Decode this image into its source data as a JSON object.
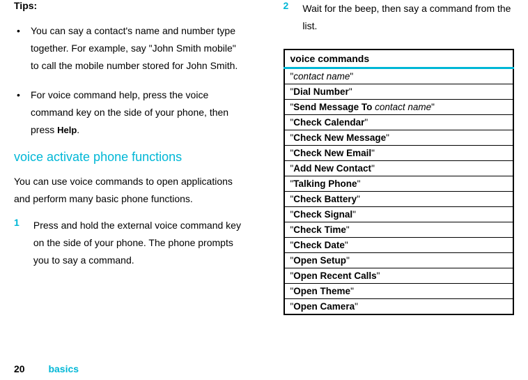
{
  "left": {
    "tips_label": "Tips:",
    "bullets": [
      "You can say a contact's name and number type together. For example, say \"John Smith mobile\" to call the mobile number stored for John Smith.",
      "For voice command help, press the voice command key on the side of your phone, then press "
    ],
    "help_label": "Help",
    "bullet2_suffix": ".",
    "section_heading": "voice activate phone functions",
    "intro_para": "You can use voice commands to open applications and perform many basic phone functions.",
    "step1_number": "1",
    "step1_text": "Press and hold the external voice command key on the side of your phone. The phone prompts you to say a command."
  },
  "right": {
    "step2_number": "2",
    "step2_text": "Wait for the beep, then say a command from the list.",
    "table_header": "voice commands",
    "rows": [
      {
        "prefix": "\"",
        "italic": "contact name",
        "bold": "",
        "suffix": "\""
      },
      {
        "prefix": "\"",
        "bold": "Dial Number",
        "suffix": "\""
      },
      {
        "prefix": "\"",
        "bold": "Send Message To",
        "italic": " contact name",
        "suffix": "\""
      },
      {
        "prefix": "\"",
        "bold": "Check Calendar",
        "suffix": "\""
      },
      {
        "prefix": "\"",
        "bold": "Check New Message",
        "suffix": "\""
      },
      {
        "prefix": "\"",
        "bold": "Check New Email",
        "suffix": "\""
      },
      {
        "prefix": "\"",
        "bold": "Add New Contact",
        "suffix": "\""
      },
      {
        "prefix": "\"",
        "bold": "Talking Phone",
        "suffix": "\""
      },
      {
        "prefix": "\"",
        "bold": "Check Battery",
        "suffix": "\""
      },
      {
        "prefix": "\"",
        "bold": "Check Signal",
        "suffix": "\""
      },
      {
        "prefix": "\"",
        "bold": "Check Time",
        "suffix": "\""
      },
      {
        "prefix": "\"",
        "bold": "Check Date",
        "suffix": "\""
      },
      {
        "prefix": "\"",
        "bold": "Open Setup",
        "suffix": "\""
      },
      {
        "prefix": "\"",
        "bold": "Open Recent Calls",
        "suffix": "\""
      },
      {
        "prefix": "\"",
        "bold": "Open Theme",
        "suffix": "\""
      },
      {
        "prefix": "\"",
        "bold": "Open Camera",
        "suffix": "\""
      }
    ]
  },
  "footer": {
    "page_number": "20",
    "label": "basics"
  }
}
